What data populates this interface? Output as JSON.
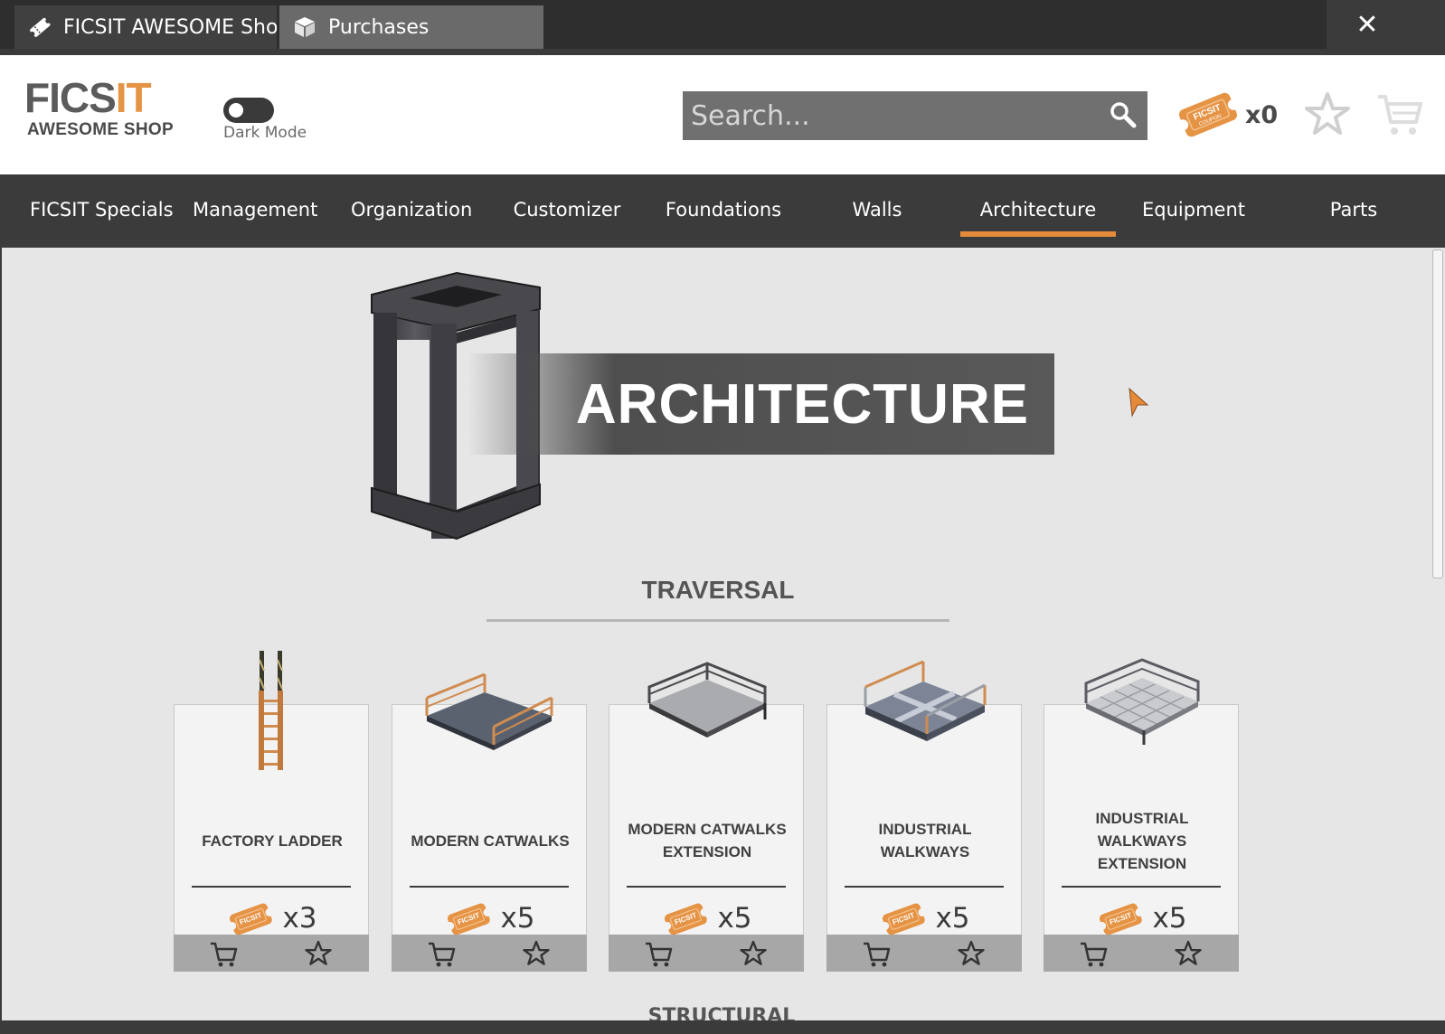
{
  "tabs": [
    {
      "label": "FICSIT AWESOME Shop",
      "icon": "coupon-tag-icon"
    },
    {
      "label": "Purchases",
      "icon": "package-icon"
    }
  ],
  "window": {
    "close_label": "✕"
  },
  "header": {
    "logo": {
      "main_left": "FICS",
      "main_accent": "IT",
      "subtitle": "AWESOME SHOP"
    },
    "dark_mode_label": "Dark Mode",
    "search_placeholder": "Search...",
    "coupon_count": "x0"
  },
  "nav": {
    "items": [
      "FICSIT Specials",
      "Management",
      "Organization",
      "Customizer",
      "Foundations",
      "Walls",
      "Architecture",
      "Equipment",
      "Parts"
    ],
    "active": "Architecture"
  },
  "main": {
    "banner_title": "ARCHITECTURE",
    "section_title": "TRAVERSAL",
    "next_section_peek": "STRUCTURAL"
  },
  "products": [
    {
      "name": "FACTORY LADDER",
      "price": "x3",
      "icon": "ladder-icon"
    },
    {
      "name": "MODERN CATWALKS",
      "price": "x5",
      "icon": "catwalk-icon"
    },
    {
      "name": "MODERN CATWALKS EXTENSION",
      "price": "x5",
      "icon": "catwalk-extension-icon"
    },
    {
      "name": "INDUSTRIAL WALKWAYS",
      "price": "x5",
      "icon": "walkway-icon"
    },
    {
      "name": "INDUSTRIAL WALKWAYS EXTENSION",
      "price": "x5",
      "icon": "walkway-extension-icon"
    }
  ],
  "colors": {
    "accent": "#e5893b",
    "nav_bg": "#3b3b3b",
    "content_bg": "#e6e6e6",
    "coupon": "#e59345"
  }
}
